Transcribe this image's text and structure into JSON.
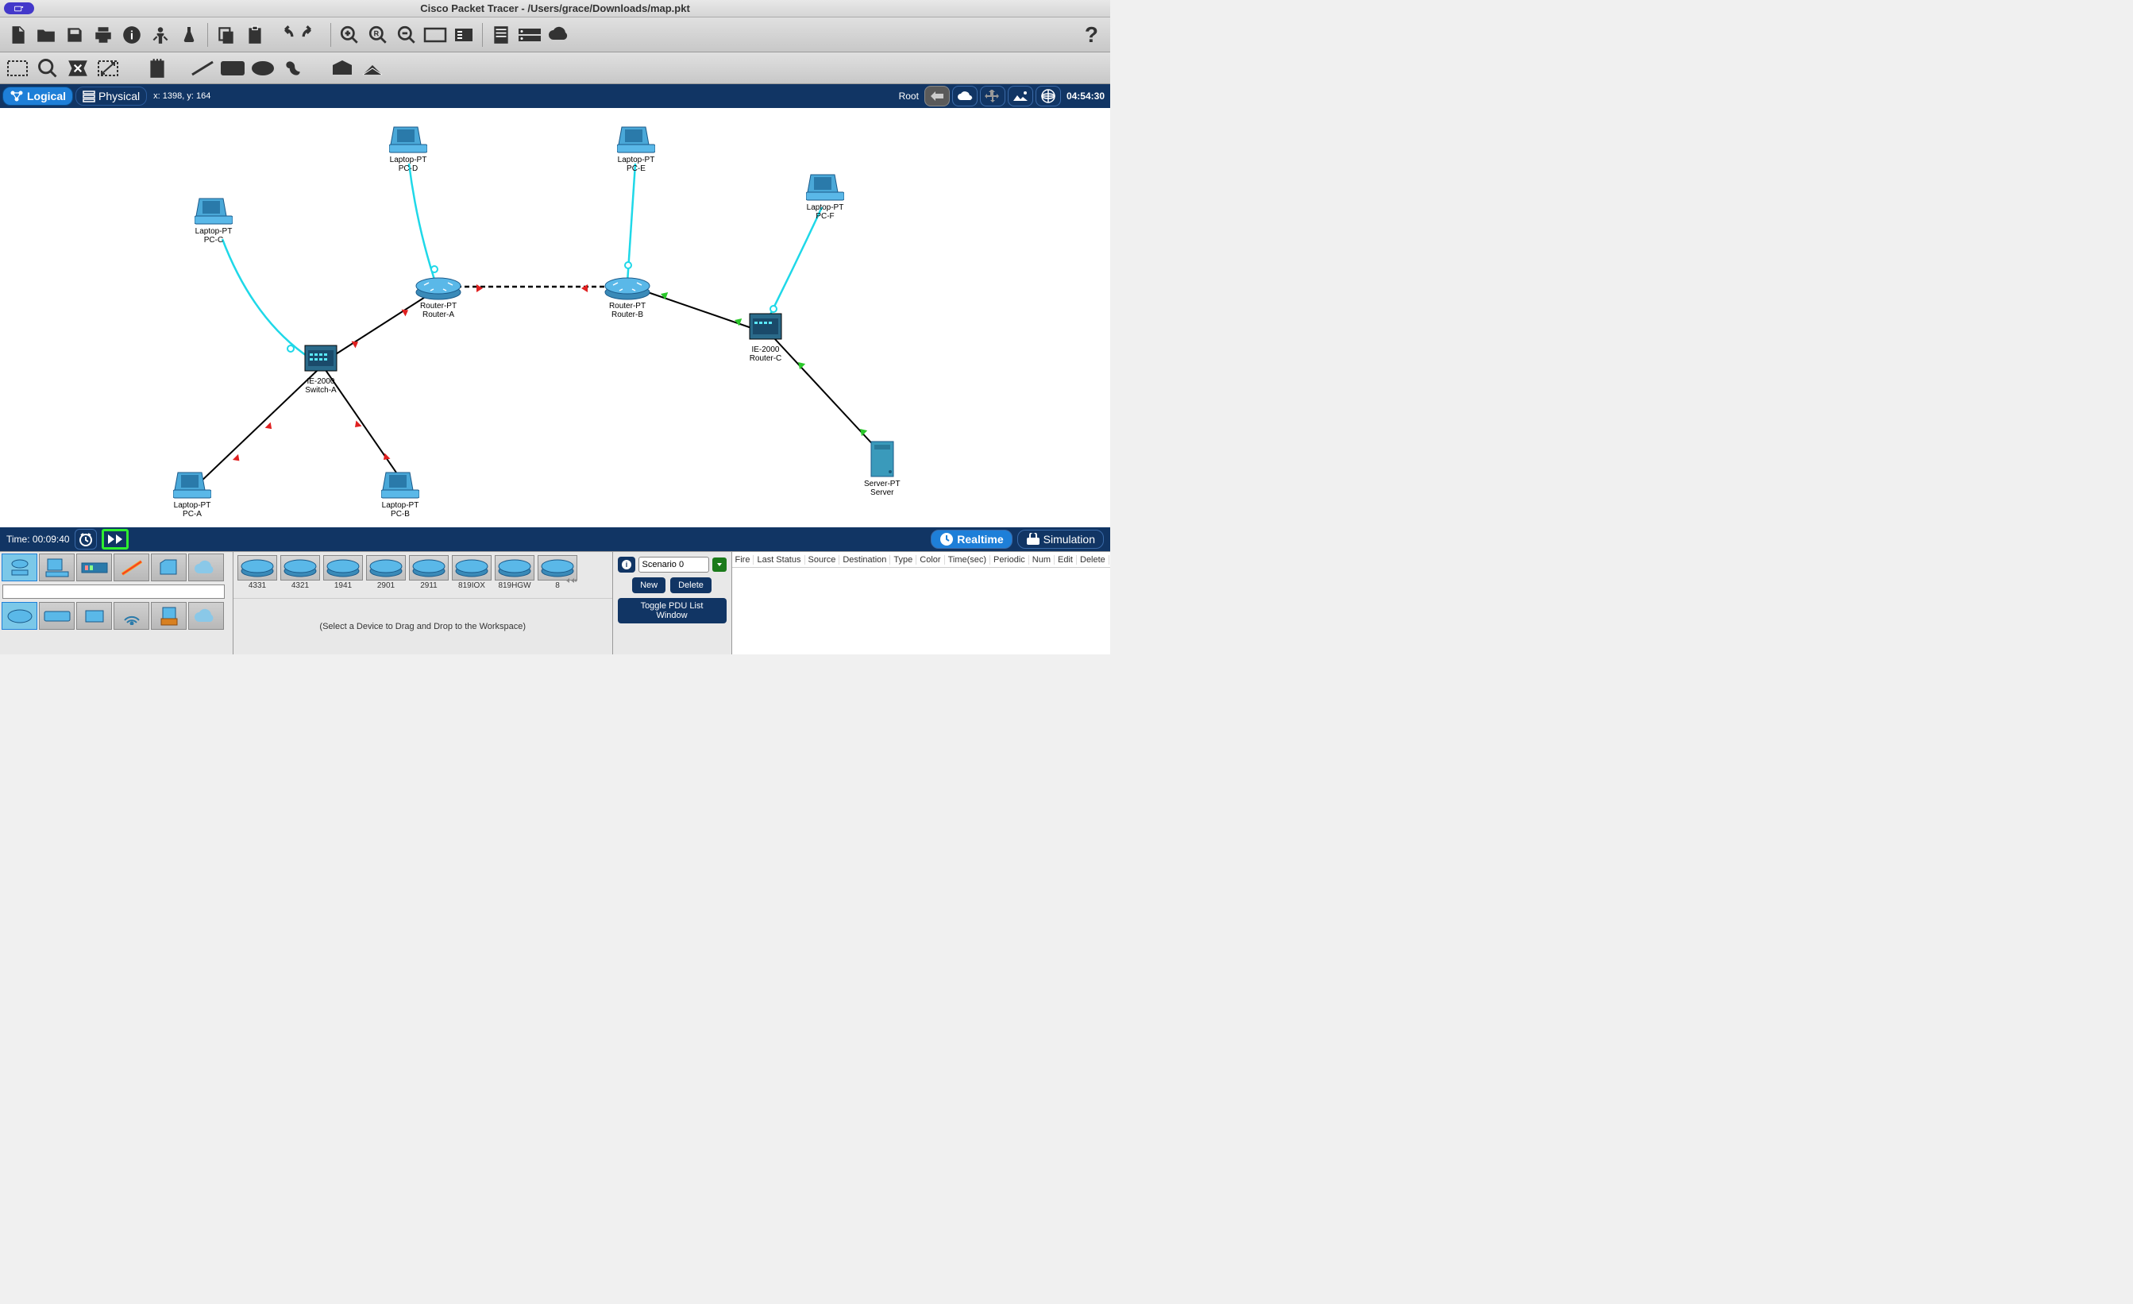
{
  "titlebar": {
    "title": "Cisco Packet Tracer - /Users/grace/Downloads/map.pkt"
  },
  "viewbar": {
    "logical": "Logical",
    "physical": "Physical",
    "coords": "x: 1398, y: 164",
    "root": "Root",
    "time": "04:54:30"
  },
  "devices": {
    "pc_c": {
      "line1": "Laptop-PT",
      "line2": "PC-C"
    },
    "pc_d": {
      "line1": "Laptop-PT",
      "line2": "PC-D"
    },
    "pc_e": {
      "line1": "Laptop-PT",
      "line2": "PC-E"
    },
    "pc_f": {
      "line1": "Laptop-PT",
      "line2": "PC-F"
    },
    "pc_a": {
      "line1": "Laptop-PT",
      "line2": "PC-A"
    },
    "pc_b": {
      "line1": "Laptop-PT",
      "line2": "PC-B"
    },
    "switch_a": {
      "line1": "IE-2000",
      "line2": "Switch-A"
    },
    "router_a": {
      "line1": "Router-PT",
      "line2": "Router-A"
    },
    "router_b": {
      "line1": "Router-PT",
      "line2": "Router-B"
    },
    "router_c": {
      "line1": "IE-2000",
      "line2": "Router-C"
    },
    "server": {
      "line1": "Server-PT",
      "line2": "Server"
    }
  },
  "bottombar": {
    "time_label": "Time: 00:09:40",
    "realtime": "Realtime",
    "simulation": "Simulation"
  },
  "device_list": [
    {
      "name": "4331"
    },
    {
      "name": "4321"
    },
    {
      "name": "1941"
    },
    {
      "name": "2901"
    },
    {
      "name": "2911"
    },
    {
      "name": "819IOX"
    },
    {
      "name": "819HGW"
    },
    {
      "name": "8"
    }
  ],
  "device_hint": "(Select a Device to Drag and Drop to the Workspace)",
  "scenario": {
    "label": "Scenario 0",
    "new": "New",
    "delete": "Delete",
    "toggle": "Toggle PDU List Window"
  },
  "pdu_headers": [
    "Fire",
    "Last Status",
    "Source",
    "Destination",
    "Type",
    "Color",
    "Time(sec)",
    "Periodic",
    "Num",
    "Edit",
    "Delete"
  ]
}
